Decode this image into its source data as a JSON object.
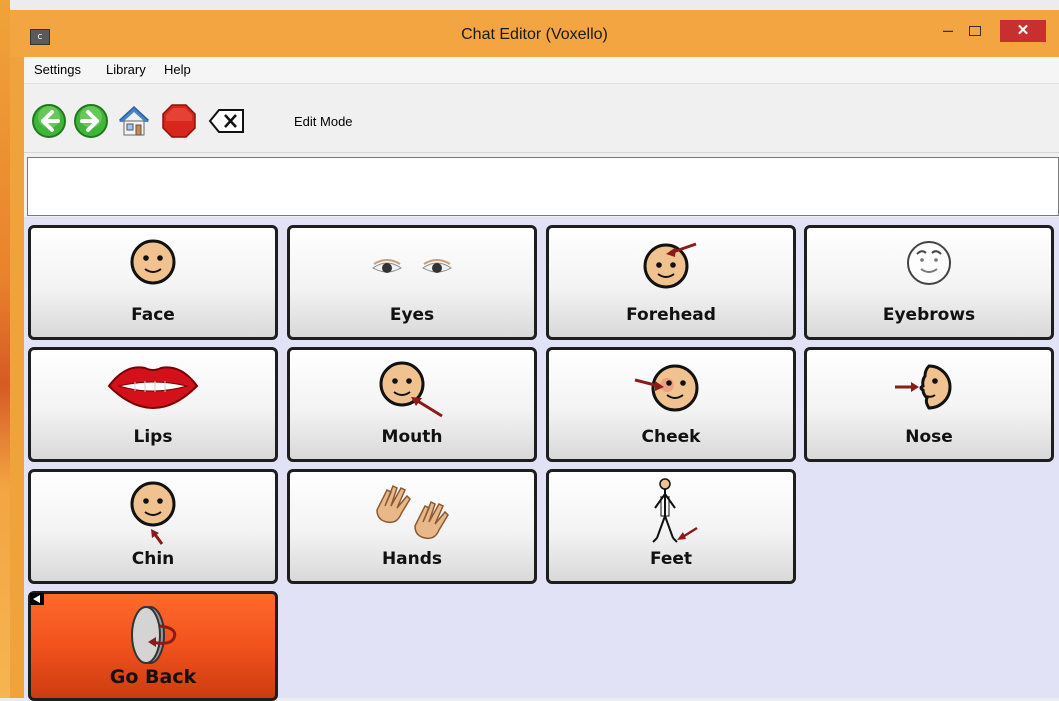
{
  "window": {
    "title": "Chat Editor (Voxello)",
    "app_icon_text": "C",
    "controls": {
      "minimize": "–",
      "close": "✕"
    }
  },
  "menu": [
    {
      "label": "Settings"
    },
    {
      "label": "Library"
    },
    {
      "label": "Help"
    }
  ],
  "toolbar": {
    "back_icon": "back-arrow-icon",
    "forward_icon": "forward-arrow-icon",
    "home_icon": "home-icon",
    "stop_icon": "stop-icon",
    "clear_icon": "backspace-clear-icon",
    "mode_label": "Edit Mode"
  },
  "message_bar": {
    "value": ""
  },
  "colors": {
    "title_bar": "#f3a542",
    "grid_background": "#e2e2f6",
    "go_back_button": "#f2521d",
    "skin": "#f0c28f",
    "arrow": "#8b1b1b"
  },
  "grid": {
    "cells": [
      {
        "label": "Face",
        "icon": "face-icon"
      },
      {
        "label": "Eyes",
        "icon": "eyes-icon"
      },
      {
        "label": "Forehead",
        "icon": "forehead-icon"
      },
      {
        "label": "Eyebrows",
        "icon": "eyebrows-icon"
      },
      {
        "label": "Lips",
        "icon": "lips-icon"
      },
      {
        "label": "Mouth",
        "icon": "mouth-icon"
      },
      {
        "label": "Cheek",
        "icon": "cheek-icon"
      },
      {
        "label": "Nose",
        "icon": "nose-icon"
      },
      {
        "label": "Chin",
        "icon": "chin-icon"
      },
      {
        "label": "Hands",
        "icon": "hands-icon"
      },
      {
        "label": "Feet",
        "icon": "feet-icon"
      }
    ],
    "go_back": {
      "label": "Go Back",
      "icon": "go-back-icon"
    }
  }
}
